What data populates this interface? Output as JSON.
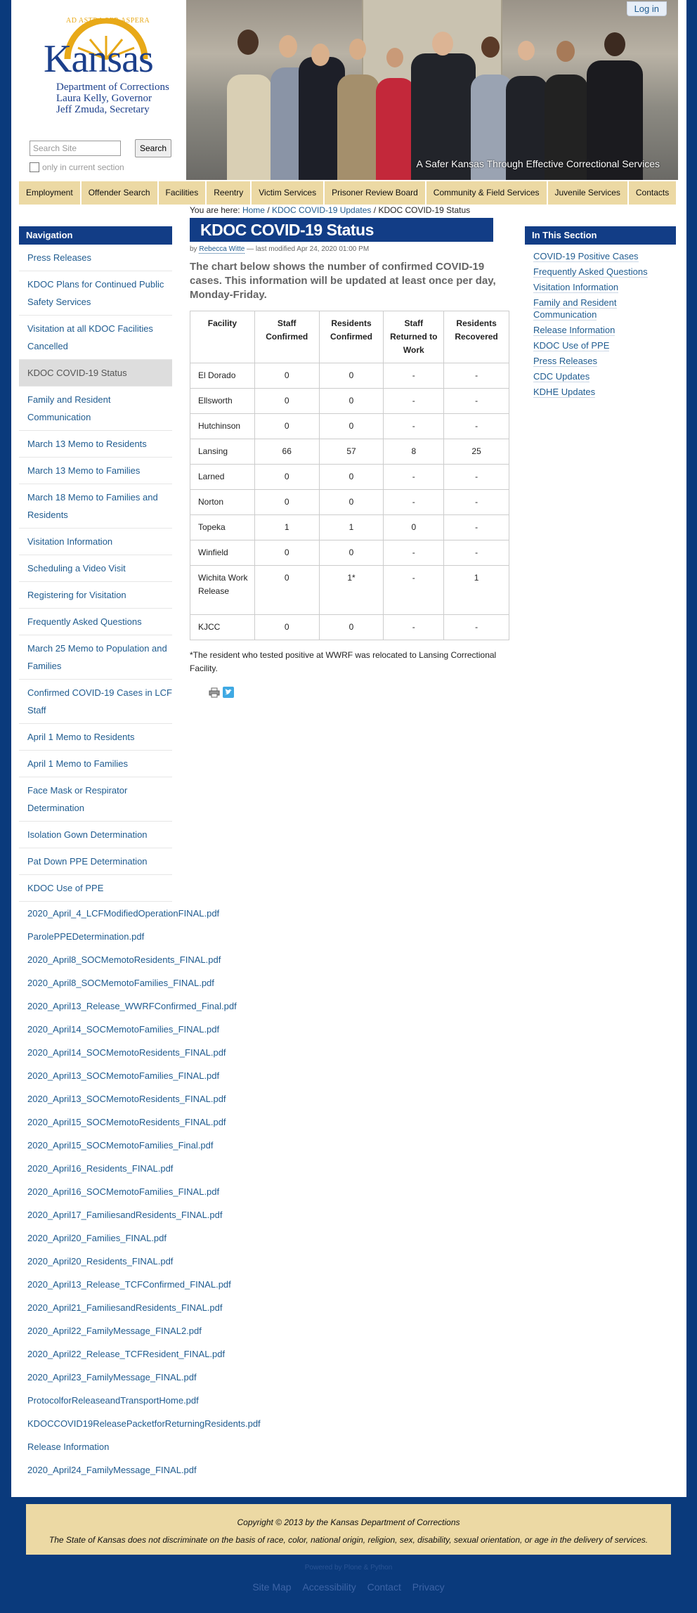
{
  "header": {
    "logo_motto": "AD ASTRA PER ASPERA",
    "logo_name": "Kansas",
    "logo_lines": [
      "Department of Corrections",
      "Laura Kelly, Governor",
      "Jeff Zmuda, Secretary"
    ],
    "search_placeholder": "Search Site",
    "search_button": "Search",
    "search_scope": "only in current section",
    "photo_caption": "A Safer Kansas Through Effective Correctional Services",
    "login": "Log in"
  },
  "globalnav": [
    "Employment",
    "Offender Search",
    "Facilities",
    "Reentry",
    "Victim Services",
    "Prisoner Review Board",
    "Community & Field Services",
    "Juvenile Services",
    "Contacts"
  ],
  "navigation": {
    "title": "Navigation",
    "items": [
      "Press Releases",
      "KDOC Plans for Continued Public Safety Services",
      "Visitation at all KDOC Facilities Cancelled",
      "KDOC COVID-19 Status",
      "Family and Resident Communication",
      "March 13 Memo to Residents",
      "March 13 Memo to Families",
      "March 18 Memo to Families and Residents",
      "Visitation Information",
      "Scheduling a Video Visit",
      "Registering for Visitation",
      "Frequently Asked Questions",
      "March 25 Memo to Population and Families",
      "Confirmed COVID-19 Cases in LCF Staff",
      "April 1 Memo to Residents",
      "April 1 Memo to Families",
      "Face Mask or Respirator Determination",
      "Isolation Gown Determination",
      "Pat Down PPE Determination",
      "KDOC Use of PPE"
    ],
    "files": [
      "2020_April_4_LCFModifiedOperationFINAL.pdf",
      "ParolePPEDetermination.pdf",
      "2020_April8_SOCMemotoResidents_FINAL.pdf",
      "2020_April8_SOCMemotoFamilies_FINAL.pdf",
      "2020_April13_Release_WWRFConfirmed_Final.pdf",
      "2020_April14_SOCMemotoFamilies_FINAL.pdf",
      "2020_April14_SOCMemotoResidents_FINAL.pdf",
      "2020_April13_SOCMemotoFamilies_FINAL.pdf",
      "2020_April13_SOCMemotoResidents_FINAL.pdf",
      "2020_April15_SOCMemotoResidents_FINAL.pdf",
      "2020_April15_SOCMemotoFamilies_Final.pdf",
      "2020_April16_Residents_FINAL.pdf",
      "2020_April16_SOCMemotoFamilies_FINAL.pdf",
      "2020_April17_FamiliesandResidents_FINAL.pdf",
      "2020_April20_Families_FINAL.pdf",
      "2020_April20_Residents_FINAL.pdf",
      "2020_April13_Release_TCFConfirmed_FINAL.pdf",
      "2020_April21_FamiliesandResidents_FINAL.pdf",
      "2020_April22_FamilyMessage_FINAL2.pdf",
      "2020_April22_Release_TCFResident_FINAL.pdf",
      "2020_April23_FamilyMessage_FINAL.pdf",
      "ProtocolforReleaseandTransportHome.pdf",
      "KDOCCOVID19ReleasePacketforReturningResidents.pdf",
      "Release Information",
      "2020_April24_FamilyMessage_FINAL.pdf"
    ]
  },
  "breadcrumb": {
    "prefix": "You are here:",
    "home": "Home",
    "sep": "/",
    "parent": "KDOC COVID-19 Updates",
    "current": "KDOC COVID-19 Status"
  },
  "page": {
    "title": "KDOC COVID-19 Status",
    "by": "by",
    "author": "Rebecca Witte",
    "modified": "— last modified Apr 24, 2020 01:00 PM",
    "description": "The chart below shows the number of confirmed COVID-19 cases. This information will be updated at least once per day, Monday-Friday.",
    "footnote": "*The resident who tested positive at WWRF was relocated to Lansing Correctional Facility."
  },
  "table": {
    "headers": [
      "Facility",
      "Staff Confirmed",
      "Residents Confirmed",
      "Staff Returned to Work",
      "Residents Recovered"
    ],
    "rows": [
      [
        "El Dorado",
        "0",
        "0",
        "-",
        "-"
      ],
      [
        "Ellsworth",
        "0",
        "0",
        "-",
        "-"
      ],
      [
        "Hutchinson",
        "0",
        "0",
        "-",
        "-"
      ],
      [
        "Lansing",
        "66",
        "57",
        "8",
        "25"
      ],
      [
        "Larned",
        "0",
        "0",
        "-",
        "-"
      ],
      [
        "Norton",
        "0",
        "0",
        "-",
        "-"
      ],
      [
        "Topeka",
        "1",
        "1",
        "0",
        "-"
      ],
      [
        "Winfield",
        "0",
        "0",
        "-",
        "-"
      ],
      [
        "Wichita Work Release",
        "0",
        "1*",
        "-",
        "1"
      ],
      [
        "KJCC",
        "0",
        "0",
        "-",
        "-"
      ]
    ]
  },
  "in_this_section": {
    "title": "In This Section",
    "items": [
      "COVID-19 Positive Cases",
      "Frequently Asked Questions",
      "Visitation Information",
      "Family and Resident Communication",
      "Release Information",
      "KDOC Use of PPE",
      "Press Releases",
      "CDC Updates",
      "KDHE Updates"
    ]
  },
  "footer": {
    "copyright": "Copyright © 2013 by the Kansas Department of Corrections",
    "notice": "The State of Kansas does not discriminate on the basis of race, color, national origin, religion, sex, disability, sexual orientation, or age in the delivery of services.",
    "powered": "Powered by Plone & Python",
    "links": [
      "Site Map",
      "Accessibility",
      "Contact",
      "Privacy"
    ]
  },
  "colors": {
    "brand_blue": "#123d86",
    "nav_tan": "#ecd9a4",
    "link": "#205c90"
  }
}
